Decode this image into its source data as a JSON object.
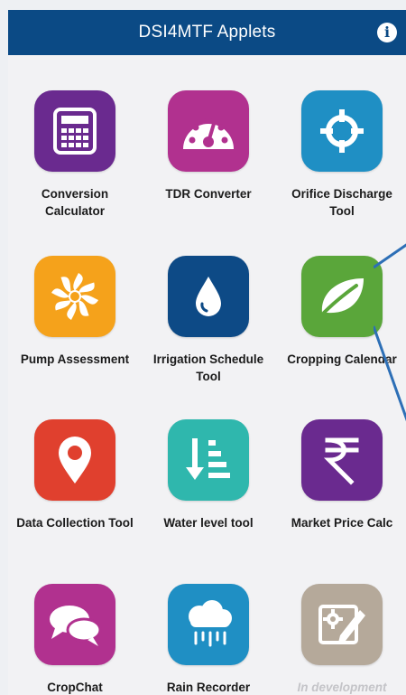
{
  "header": {
    "title": "DSI4MTF Applets",
    "info_glyph": "i"
  },
  "apps": [
    {
      "label": "Conversion Calculator",
      "icon": "calculator-icon",
      "color": "#6a2a8f"
    },
    {
      "label": "TDR Converter",
      "icon": "gauge-icon",
      "color": "#b1318f"
    },
    {
      "label": "Orifice Discharge Tool",
      "icon": "crosshair-icon",
      "color": "#1f8fc4"
    },
    {
      "label": "Pump Assessment",
      "icon": "pinwheel-icon",
      "color": "#f5a21b"
    },
    {
      "label": "Irrigation Schedule Tool",
      "icon": "water-drop-icon",
      "color": "#0d4a86"
    },
    {
      "label": "Cropping Calendar",
      "icon": "leaf-icon",
      "color": "#5aa63a"
    },
    {
      "label": "Data Collection Tool",
      "icon": "map-pin-icon",
      "color": "#e0402e"
    },
    {
      "label": "Water level tool",
      "icon": "sort-descending-icon",
      "color": "#2fb7ad"
    },
    {
      "label": "Market Price Calc",
      "icon": "rupee-icon",
      "color": "#6a2a8f"
    },
    {
      "label": "CropChat",
      "icon": "chat-bubbles-icon",
      "color": "#b1318f"
    },
    {
      "label": "Rain Recorder",
      "icon": "rain-cloud-icon",
      "color": "#1f8fc4"
    },
    {
      "label": "In development",
      "icon": "settings-edit-icon",
      "color": "#b5a99a"
    }
  ]
}
